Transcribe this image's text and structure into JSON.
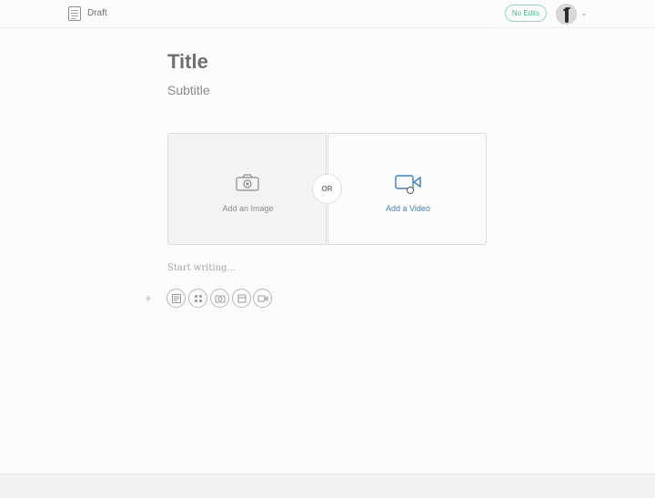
{
  "topbar": {
    "doc_label": "Draft",
    "status_badge": "No Edits"
  },
  "editor": {
    "title": "Title",
    "subtitle": "Subtitle",
    "media": {
      "add_image": "Add an Image",
      "or": "OR",
      "add_video": "Add a Video"
    },
    "placeholder": "Start writing...",
    "toolbar": {
      "plus": "+",
      "tools": [
        "text-block-icon",
        "grid-icon",
        "camera-icon",
        "embed-icon",
        "video-icon"
      ]
    }
  },
  "colors": {
    "accent_green": "#3fb58a",
    "link_blue": "#3f84bd"
  }
}
